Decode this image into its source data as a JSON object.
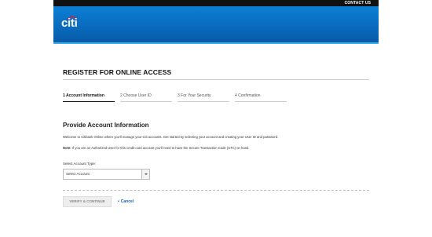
{
  "header": {
    "contact_label": "CONTACT US",
    "logo_text": "citi",
    "brand_color": "#0a6fc2",
    "accent_color": "#3db0ea"
  },
  "main": {
    "title": "REGISTER FOR ONLINE ACCESS",
    "steps": [
      {
        "label": "1 Account Information",
        "active": true
      },
      {
        "label": "2 Choose User ID",
        "active": false
      },
      {
        "label": "3 For Your Security",
        "active": false
      },
      {
        "label": "4 Confirmation",
        "active": false
      }
    ],
    "section_title": "Provide Account Information",
    "welcome_text": "Welcome to Citibank Online where you'll manage your Citi accounts. Get started by selecting your account and creating your User ID and password.",
    "note_label": "Note:",
    "note_text": " If you are an Authorized User for this credit card account you'll need to have the Secure Transaction Code (STC) on hand.",
    "select": {
      "label": "Select Account Type:",
      "value": "Select Account",
      "icon": "chevron-down-icon"
    },
    "actions": {
      "verify_label": "VERIFY & CONTINUE",
      "cancel_bullet": "•",
      "cancel_label": "Cancel",
      "link_color": "#1a5fb4"
    }
  }
}
